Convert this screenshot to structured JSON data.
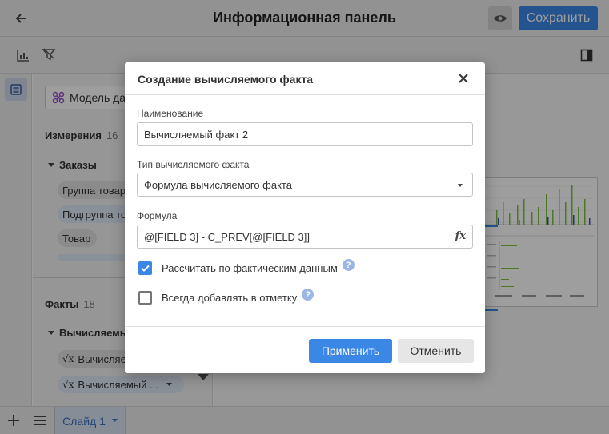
{
  "header": {
    "title": "Информационная панель",
    "save_label": "Сохранить"
  },
  "side_panel": {
    "model_label": "Модель да",
    "dimensions_title": "Измерения",
    "dimensions_count": "16",
    "orders_group": "Заказы",
    "dimension_items": [
      "Группа товар",
      "Подгруппа то",
      "Товар"
    ],
    "facts_title": "Факты",
    "facts_count": "18",
    "calc_group": "Вычисляемы",
    "fact_items": [
      "Вычисляе",
      "Вычисляемый ..."
    ]
  },
  "bottom_bar": {
    "slide_tab": "Слайд 1"
  },
  "dialog": {
    "title": "Создание вычисляемого факта",
    "name_label": "Наименование",
    "name_value": "Вычисляемый факт 2",
    "type_label": "Тип вычисляемого факта",
    "type_value": "Формула вычисляемого факта",
    "formula_label": "Формула",
    "formula_value": "@[FIELD 3] - C_PREV[@[FIELD 3]]",
    "fx_label": "fx",
    "calc_actual_label": "Рассчитать по фактическим данным",
    "calc_actual_checked": true,
    "always_add_label": "Всегда добавлять в отметку",
    "always_add_checked": false,
    "apply_label": "Применить",
    "cancel_label": "Отменить"
  },
  "colors": {
    "accent": "#3b87e6",
    "header_bg": "#ececec",
    "chip_blue": "#dfe9f5",
    "chip_gray": "#e1e1e1"
  }
}
